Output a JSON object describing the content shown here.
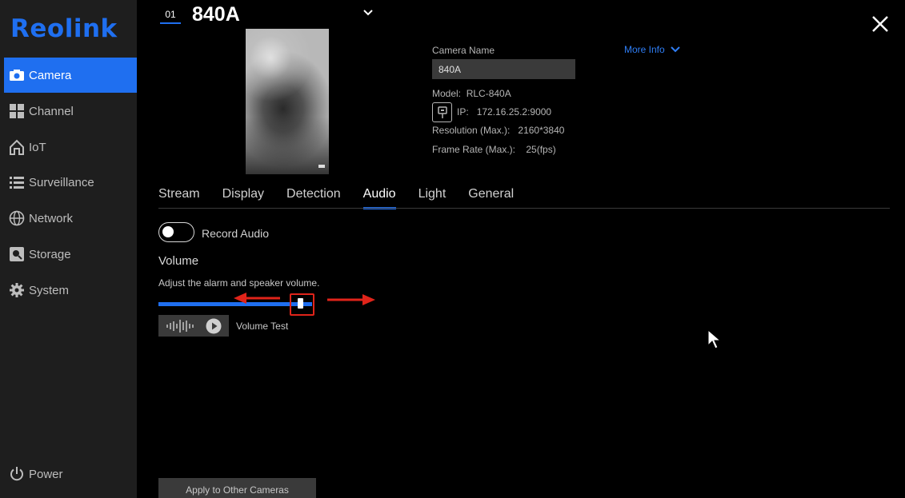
{
  "app": {
    "logo_text": "Reolink",
    "accent_color": "#1f6ff0"
  },
  "sidebar": {
    "items": [
      {
        "label": "Camera",
        "icon": "camera-icon",
        "active": true
      },
      {
        "label": "Channel",
        "icon": "grid-icon",
        "active": false
      },
      {
        "label": "IoT",
        "icon": "home-icon",
        "active": false
      },
      {
        "label": "Surveillance",
        "icon": "list-icon",
        "active": false
      },
      {
        "label": "Network",
        "icon": "globe-icon",
        "active": false
      },
      {
        "label": "Storage",
        "icon": "storage-icon",
        "active": false
      },
      {
        "label": "System",
        "icon": "gear-icon",
        "active": false
      }
    ],
    "power_label": "Power"
  },
  "header": {
    "channel_number": "01",
    "camera_title": "840A"
  },
  "info": {
    "camera_name_label": "Camera Name",
    "camera_name_value": "840A",
    "more_info_label": "More Info",
    "model_label": "Model:",
    "model_value": "RLC-840A",
    "ip_label": "IP:",
    "ip_value": "172.16.25.2:9000",
    "resolution_label": "Resolution (Max.):",
    "resolution_value": "2160*3840",
    "framerate_label": "Frame Rate (Max.):",
    "framerate_value": "25(fps)"
  },
  "tabs": [
    {
      "label": "Stream",
      "active": false
    },
    {
      "label": "Display",
      "active": false
    },
    {
      "label": "Detection",
      "active": false
    },
    {
      "label": "Audio",
      "active": true
    },
    {
      "label": "Light",
      "active": false
    },
    {
      "label": "General",
      "active": false
    }
  ],
  "audio": {
    "record_audio_label": "Record Audio",
    "record_audio_enabled": false,
    "volume_title": "Volume",
    "volume_description": "Adjust the alarm and speaker volume.",
    "volume_level_fraction": 0.92,
    "volume_test_label": "Volume Test"
  },
  "footer": {
    "apply_label": "Apply to Other Cameras"
  },
  "annotation_color": "#e0241a"
}
